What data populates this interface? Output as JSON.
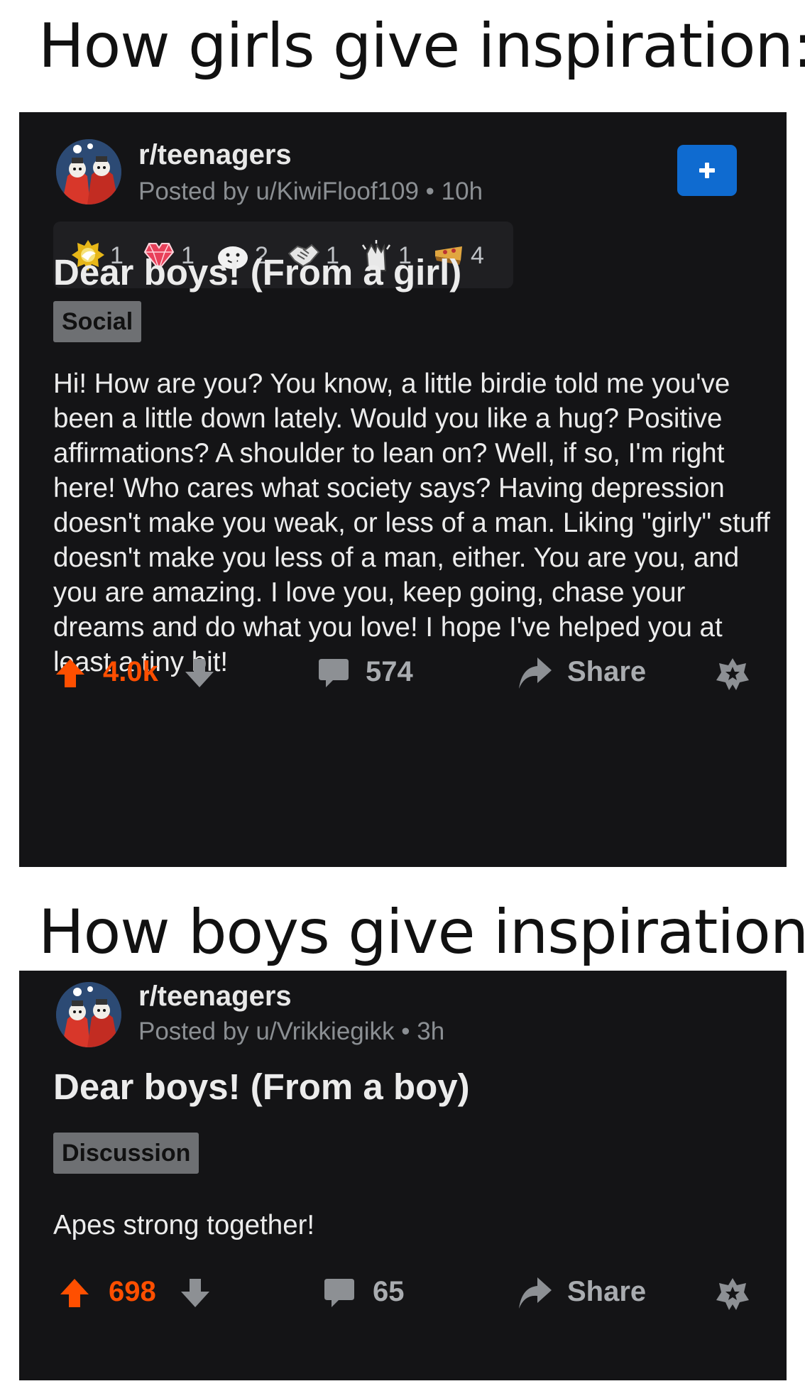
{
  "captions": {
    "top": "How girls give inspiration:",
    "middle": "How boys give inspiration:"
  },
  "post1": {
    "subreddit": "r/teenagers",
    "meta": "Posted by u/KiwiFloof109 • 10h",
    "awards": [
      {
        "icon": "golden-award-icon",
        "count": "1"
      },
      {
        "icon": "gem-heart-icon",
        "count": "1"
      },
      {
        "icon": "smiling-face-icon",
        "count": "2"
      },
      {
        "icon": "handshake-icon",
        "count": "1"
      },
      {
        "icon": "clapping-hands-icon",
        "count": "1"
      },
      {
        "icon": "pie-slice-icon",
        "count": "4"
      }
    ],
    "title": "Dear boys! (From a girl)",
    "flair": "Social",
    "body": "Hi! How are you? You know, a little birdie told me you've been a little down lately. Would you like a hug? Positive affirmations? A shoulder to lean on? Well, if so, I'm right here! Who cares what society says? Having depression doesn't make you weak, or less of a man. Liking \"girly\" stuff doesn't make you less of a man, either. You are you, and you are amazing. I love you, keep going, chase your dreams and do what you love! I hope I've helped you at least a tiny bit!",
    "score": "4.0k",
    "comments": "574",
    "share": "Share"
  },
  "post2": {
    "subreddit": "r/teenagers",
    "meta": "Posted by u/Vrikkiegikk • 3h",
    "title": "Dear boys! (From a boy)",
    "flair": "Discussion",
    "body": "Apes strong together!",
    "score": "698",
    "comments": "65",
    "share": "Share"
  },
  "colors": {
    "card_bg": "#141416",
    "upvote": "#ff4f00",
    "join_button": "#0f6bd0",
    "flair_bg": "#6e7073",
    "muted_text": "#8b8f93"
  }
}
